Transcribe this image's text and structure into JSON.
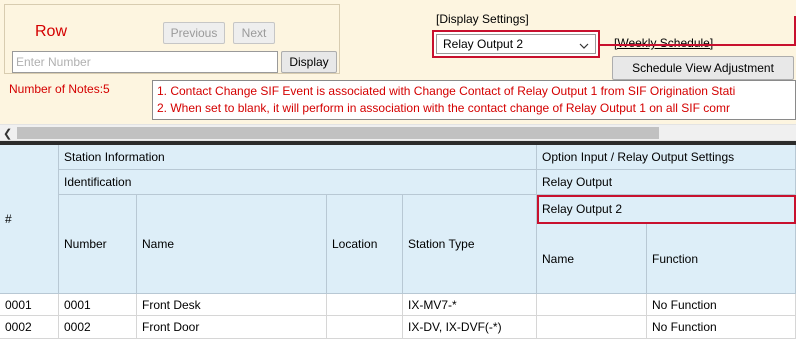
{
  "row_panel": {
    "title": "Row",
    "previous_label": "Previous",
    "next_label": "Next",
    "number_placeholder": "Enter Number",
    "display_label": "Display"
  },
  "display_settings": {
    "label": "[Display Settings]",
    "selected": "Relay Output 2"
  },
  "weekly_schedule": {
    "label": "[Weekly Schedule]",
    "button_label": "Schedule View Adjustment"
  },
  "notes": {
    "count_label": "Number of Notes:5",
    "lines": [
      "1. Contact Change SIF Event is associated with Change Contact of Relay Output 1 from SIF Origination Stati",
      "2. When set to blank, it will perform in association with the contact change of Relay Output 1 on all SIF comr"
    ]
  },
  "grid": {
    "header": {
      "hash": "#",
      "station_information": "Station Information",
      "identification": "Identification",
      "number": "Number",
      "name": "Name",
      "location": "Location",
      "station_type": "Station Type",
      "option_settings": "Option Input / Relay Output Settings",
      "relay_output": "Relay Output",
      "relay_output_2": "Relay Output 2",
      "relay_name": "Name",
      "function": "Function"
    },
    "rows": [
      {
        "id": "0001",
        "number": "0001",
        "name": "Front Desk",
        "location": "",
        "station_type": "IX-MV7-*",
        "relay_name": "",
        "function": "No Function"
      },
      {
        "id": "0002",
        "number": "0002",
        "name": "Front Door",
        "location": "",
        "station_type": "IX-DV, IX-DVF(-*)",
        "relay_name": "",
        "function": "No Function"
      }
    ]
  },
  "colors": {
    "accent_red": "#c8102e",
    "header_blue": "#ddeef8",
    "panel_cream": "#fdf5e0"
  }
}
